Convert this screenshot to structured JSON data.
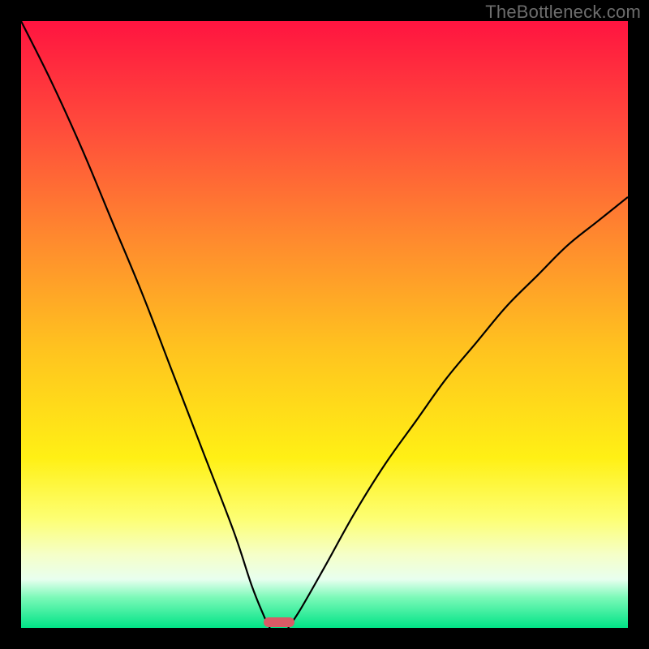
{
  "watermark": "TheBottleneck.com",
  "chart_data": {
    "type": "line",
    "title": "",
    "xlabel": "",
    "ylabel": "",
    "xlim": [
      0,
      100
    ],
    "ylim": [
      0,
      100
    ],
    "grid": false,
    "legend": false,
    "series": [
      {
        "name": "left-branch",
        "x": [
          0,
          5,
          10,
          15,
          20,
          25,
          30,
          35,
          38,
          40,
          41
        ],
        "y": [
          100,
          90,
          79,
          67,
          55,
          42,
          29,
          16,
          7,
          2,
          0
        ]
      },
      {
        "name": "right-branch",
        "x": [
          44,
          46,
          50,
          55,
          60,
          65,
          70,
          75,
          80,
          85,
          90,
          95,
          100
        ],
        "y": [
          0,
          3,
          10,
          19,
          27,
          34,
          41,
          47,
          53,
          58,
          63,
          67,
          71
        ]
      }
    ],
    "marker": {
      "x": 42.5,
      "y": 0,
      "color": "#d95b66"
    },
    "background_gradient": {
      "top": "#ff1440",
      "mid": "#fff015",
      "bottom": "#00e386"
    }
  },
  "frame": {
    "inner_left": 26,
    "inner_top": 26,
    "inner_size": 748
  }
}
